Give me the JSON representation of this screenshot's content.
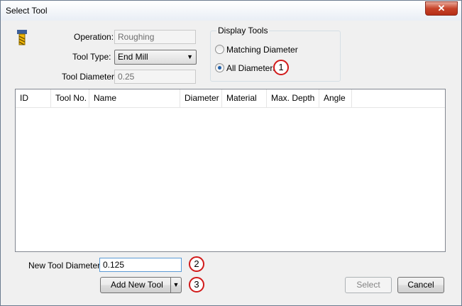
{
  "window": {
    "title": "Select Tool",
    "close_glyph": "✕"
  },
  "form": {
    "operation_label": "Operation:",
    "operation_value": "Roughing",
    "tool_type_label": "Tool Type:",
    "tool_type_value": "End Mill",
    "tool_diameter_label": "Tool Diameter",
    "tool_diameter_value": "0.25",
    "tool_icon": "end-mill-icon"
  },
  "display_tools": {
    "title": "Display Tools",
    "options": [
      {
        "label": "Matching Diameter",
        "checked": false
      },
      {
        "label": "All Diameters",
        "checked": true
      }
    ]
  },
  "table": {
    "columns": [
      "ID",
      "Tool No.",
      "Name",
      "Diameter",
      "Material",
      "Max. Depth",
      "Angle"
    ],
    "rows": []
  },
  "new_tool": {
    "diameter_label": "New Tool Diameter:",
    "diameter_value": "0.125",
    "add_button": "Add New Tool",
    "dropdown_glyph": "▼"
  },
  "buttons": {
    "select": "Select",
    "cancel": "Cancel"
  },
  "callouts": [
    "1",
    "2",
    "3"
  ],
  "colors": {
    "callout_border": "#d11a1a",
    "radio_dot": "#1f5faa",
    "close_button": "#c7442a"
  }
}
